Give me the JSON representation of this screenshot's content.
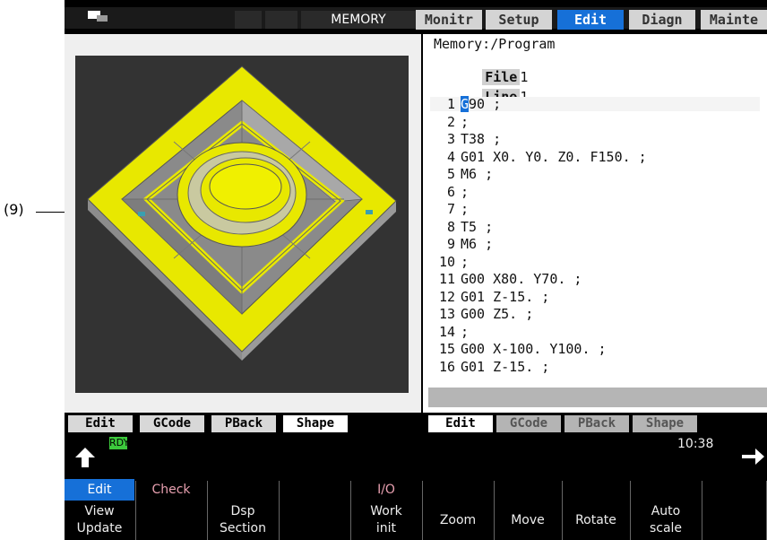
{
  "callout": {
    "label": "(9)"
  },
  "header": {
    "mode": "MEMORY",
    "tabs": [
      {
        "label": "Monitr",
        "active": false
      },
      {
        "label": "Setup",
        "active": false
      },
      {
        "label": "Edit",
        "active": true
      },
      {
        "label": "Diagn",
        "active": false
      },
      {
        "label": "Mainte",
        "active": false
      }
    ]
  },
  "program": {
    "path": "Memory:/Program",
    "file_label": "File",
    "file_value": "1",
    "line_label": "Line",
    "line_value": "1 -",
    "lines": [
      {
        "n": "1",
        "text": "G90 ;"
      },
      {
        "n": "2",
        "text": ";"
      },
      {
        "n": "3",
        "text": "T38 ;"
      },
      {
        "n": "4",
        "text": "G01 X0. Y0. Z0. F150. ;"
      },
      {
        "n": "5",
        "text": "M6 ;"
      },
      {
        "n": "6",
        "text": ";"
      },
      {
        "n": "7",
        "text": ";"
      },
      {
        "n": "8",
        "text": "T5 ;"
      },
      {
        "n": "9",
        "text": "M6 ;"
      },
      {
        "n": "10",
        "text": ";"
      },
      {
        "n": "11",
        "text": "G00 X80. Y70. ;"
      },
      {
        "n": "12",
        "text": "G01 Z-15. ;"
      },
      {
        "n": "13",
        "text": "G00 Z5. ;"
      },
      {
        "n": "14",
        "text": ";"
      },
      {
        "n": "15",
        "text": "G00 X-100. Y100. ;"
      },
      {
        "n": "16",
        "text": "G01 Z-15. ;"
      }
    ]
  },
  "left_tabs": [
    "Edit",
    "GCode",
    "PBack",
    "Shape"
  ],
  "right_tabs": [
    "Edit",
    "GCode",
    "PBack",
    "Shape"
  ],
  "status": {
    "ready": "RDY",
    "time": "10:38"
  },
  "menu": [
    {
      "top": "Edit",
      "bottom": "View\nUpdate",
      "top_active": true
    },
    {
      "top": "Check",
      "bottom": ""
    },
    {
      "top": "",
      "bottom": "Dsp\nSection"
    },
    {
      "top": "",
      "bottom": ""
    },
    {
      "top": "I/O",
      "bottom": "Work\ninit"
    },
    {
      "top": "",
      "bottom": "Zoom"
    },
    {
      "top": "",
      "bottom": "Move"
    },
    {
      "top": "",
      "bottom": "Rotate"
    },
    {
      "top": "",
      "bottom": "Auto\nscale"
    },
    {
      "top": "",
      "bottom": ""
    }
  ],
  "colors": {
    "accent": "#1670d8",
    "part": "#e8e800",
    "ready": "#3cc93c"
  }
}
